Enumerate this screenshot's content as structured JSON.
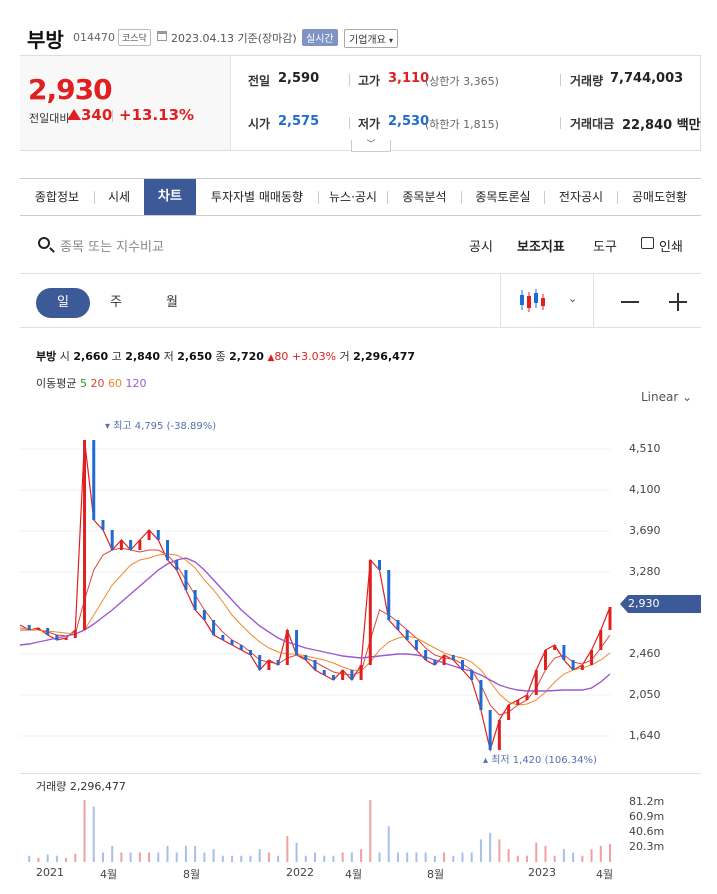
{
  "header": {
    "name": "부방",
    "code": "014470",
    "market": "코스닥",
    "date": "2023.04.13 기준(장마감)",
    "realtime_label": "실시간",
    "overview_label": "기업개요"
  },
  "price": {
    "current": "2,930",
    "change_label": "전일대비",
    "change": "340",
    "change_pct": "+13.13%",
    "prev_close_label": "전일",
    "prev_close": "2,590",
    "high_label": "고가",
    "high": "3,110",
    "upper_limit": "(상한가 3,365)",
    "volume_label": "거래량",
    "volume": "7,744,003",
    "open_label": "시가",
    "open": "2,575",
    "low_label": "저가",
    "low": "2,530",
    "lower_limit": "(하한가 1,815)",
    "amount_label": "거래대금",
    "amount": "22,840 백만"
  },
  "tabs": [
    "종합정보",
    "시세",
    "차트",
    "투자자별 매매동향",
    "뉴스·공시",
    "종목분석",
    "종목토론실",
    "전자공시",
    "공매도현황"
  ],
  "active_tab": "차트",
  "toolbar": {
    "search_placeholder": "종목 또는 지수비교",
    "disclosure": "공시",
    "indicator": "보조지표",
    "tools": "도구",
    "print": "인쇄"
  },
  "periods": [
    "일",
    "주",
    "월"
  ],
  "ohlc": {
    "name": "부방",
    "open_label": "시",
    "open": "2,660",
    "high_label": "고",
    "high": "2,840",
    "low_label": "저",
    "low": "2,650",
    "close_label": "종",
    "close": "2,720",
    "change": "80",
    "change_pct": "+3.03%",
    "vol_label": "거",
    "volume": "2,296,477"
  },
  "moving_avg": {
    "label": "이동평균",
    "p5": "5",
    "p20": "20",
    "p60": "60",
    "p120": "120"
  },
  "scale_label": "Linear",
  "annotations": {
    "high": "최고 4,795 (-38.89%)",
    "low": "최저 1,420 (106.34%)"
  },
  "price_tag": "2,930",
  "volume_panel": {
    "label": "거래량 2,296,477"
  },
  "colors": {
    "up": "#e02020",
    "down": "#1f6bd1",
    "accent": "#3d5a98",
    "ma5": "#21a021",
    "ma20": "#e0453a",
    "ma60": "#f08a2c",
    "ma120": "#9b59d0"
  },
  "chart_data": {
    "type": "line",
    "y_ticks": [
      "4,510",
      "4,100",
      "3,690",
      "3,280",
      "2,460",
      "2,050",
      "1,640"
    ],
    "volume_ticks": [
      "81.2m",
      "60.9m",
      "40.6m",
      "20.3m"
    ],
    "x_ticks": [
      "2021",
      "4월",
      "8월",
      "2022",
      "4월",
      "8월",
      "2023",
      "4월"
    ],
    "ylim": [
      1300,
      4900
    ],
    "series": [
      {
        "values": [
          2750,
          2700,
          2720,
          2650,
          2600,
          2620,
          2700,
          4600,
          3800,
          3700,
          3500,
          3600,
          3500,
          3600,
          3700,
          3600,
          3400,
          3300,
          3100,
          2900,
          2800,
          2650,
          2600,
          2550,
          2500,
          2450,
          2300,
          2400,
          2350,
          2700,
          2450,
          2400,
          2300,
          2250,
          2200,
          2300,
          2200,
          2350,
          3400,
          3300,
          2800,
          2700,
          2600,
          2500,
          2400,
          2350,
          2450,
          2400,
          2300,
          2200,
          1900,
          1500,
          1800,
          1950,
          2000,
          2050,
          2300,
          2500,
          2550,
          2400,
          2300,
          2350,
          2500,
          2700,
          2930
        ]
      },
      {
        "values": [
          2700,
          2700,
          2700,
          2680,
          2650,
          2640,
          2660,
          3000,
          3300,
          3450,
          3500,
          3520,
          3500,
          3480,
          3500,
          3500,
          3450,
          3350,
          3200,
          3050,
          2900,
          2780,
          2680,
          2600,
          2550,
          2480,
          2400,
          2380,
          2360,
          2420,
          2450,
          2420,
          2380,
          2330,
          2280,
          2260,
          2250,
          2280,
          2600,
          2900,
          2850,
          2780,
          2700,
          2620,
          2520,
          2450,
          2420,
          2410,
          2360,
          2300,
          2150,
          1950,
          1850,
          1880,
          1950,
          2000,
          2120,
          2300,
          2420,
          2450,
          2380,
          2360,
          2400,
          2520,
          2650
        ]
      },
      {
        "values": [
          2720,
          2710,
          2700,
          2690,
          2680,
          2670,
          2660,
          2700,
          2850,
          3000,
          3150,
          3250,
          3350,
          3400,
          3420,
          3450,
          3460,
          3450,
          3400,
          3320,
          3200,
          3100,
          2980,
          2850,
          2750,
          2660,
          2580,
          2520,
          2480,
          2460,
          2460,
          2440,
          2420,
          2400,
          2370,
          2330,
          2300,
          2290,
          2380,
          2500,
          2580,
          2620,
          2640,
          2620,
          2570,
          2520,
          2470,
          2440,
          2420,
          2380,
          2300,
          2180,
          2060,
          1980,
          1950,
          1960,
          2000,
          2080,
          2180,
          2260,
          2300,
          2320,
          2350,
          2400,
          2470
        ]
      },
      {
        "values": [
          2550,
          2560,
          2580,
          2600,
          2620,
          2640,
          2660,
          2700,
          2760,
          2830,
          2900,
          2980,
          3060,
          3140,
          3220,
          3300,
          3360,
          3400,
          3420,
          3380,
          3300,
          3200,
          3100,
          3000,
          2900,
          2820,
          2740,
          2680,
          2620,
          2580,
          2550,
          2520,
          2500,
          2480,
          2460,
          2440,
          2430,
          2420,
          2430,
          2440,
          2450,
          2460,
          2460,
          2450,
          2430,
          2400,
          2370,
          2340,
          2310,
          2290,
          2250,
          2200,
          2150,
          2120,
          2100,
          2090,
          2090,
          2090,
          2095,
          2100,
          2100,
          2100,
          2120,
          2180,
          2260
        ]
      }
    ]
  }
}
